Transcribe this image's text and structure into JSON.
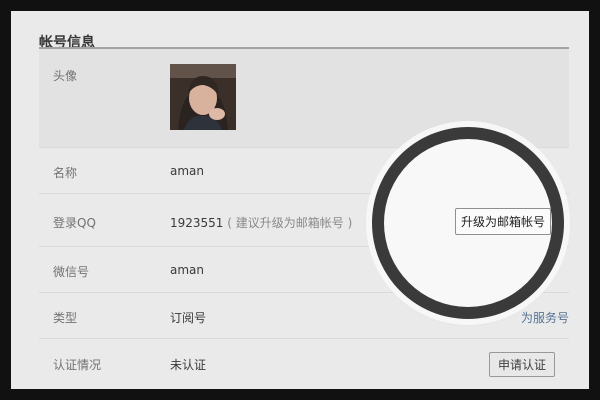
{
  "account": {
    "title": "帐号信息",
    "avatar_label": "头像",
    "name_label": "名称",
    "name_value": "aman",
    "qq_label": "登录QQ",
    "qq_value": "1923551",
    "qq_hint": "( 建议升级为邮箱帐号 )",
    "upgrade_button": "升级为邮箱帐号",
    "wechat_label": "微信号",
    "wechat_value": "aman",
    "type_label": "类型",
    "type_value": "订阅号",
    "type_link": "为服务号",
    "cert_label": "认证情况",
    "cert_value": "未认证",
    "cert_button": "申请认证"
  },
  "colors": {
    "frame": "#111111",
    "background": "#f6f6f6",
    "link": "#4d6f95",
    "magnifier_ring": "#3a3a3a"
  }
}
